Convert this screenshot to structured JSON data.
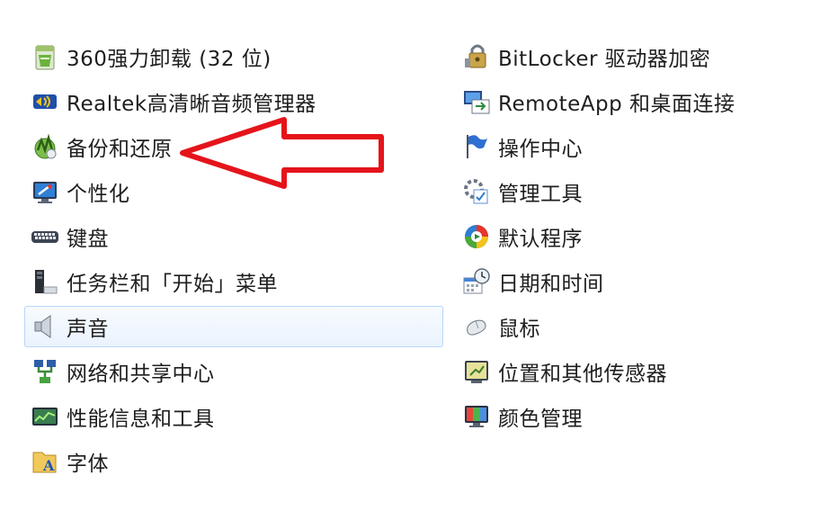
{
  "control_panel": {
    "left_items": [
      {
        "label": "360强力卸载 (32 位)",
        "icon": "uninstaller-icon"
      },
      {
        "label": "Realtek高清晰音频管理器",
        "icon": "realtek-audio-icon"
      },
      {
        "label": "备份和还原",
        "icon": "backup-restore-icon"
      },
      {
        "label": "个性化",
        "icon": "personalization-icon"
      },
      {
        "label": "键盘",
        "icon": "keyboard-icon"
      },
      {
        "label": "任务栏和「开始」菜单",
        "icon": "taskbar-icon"
      },
      {
        "label": "声音",
        "icon": "speaker-icon"
      },
      {
        "label": "网络和共享中心",
        "icon": "network-icon"
      },
      {
        "label": "性能信息和工具",
        "icon": "performance-icon"
      },
      {
        "label": "字体",
        "icon": "fonts-icon"
      }
    ],
    "right_items": [
      {
        "label": "BitLocker 驱动器加密",
        "icon": "bitlocker-icon"
      },
      {
        "label": "RemoteApp 和桌面连接",
        "icon": "remoteapp-icon"
      },
      {
        "label": "操作中心",
        "icon": "flag-icon"
      },
      {
        "label": "管理工具",
        "icon": "admin-tools-icon"
      },
      {
        "label": "默认程序",
        "icon": "default-programs-icon"
      },
      {
        "label": "日期和时间",
        "icon": "calendar-clock-icon"
      },
      {
        "label": "鼠标",
        "icon": "mouse-icon"
      },
      {
        "label": "位置和其他传感器",
        "icon": "sensor-icon"
      },
      {
        "label": "颜色管理",
        "icon": "monitor-icon"
      }
    ],
    "selected_item": "声音",
    "highlighted_item": "备份和还原"
  },
  "colors": {
    "arrow": "#e5141b",
    "selection_border": "#b8d6fb"
  }
}
